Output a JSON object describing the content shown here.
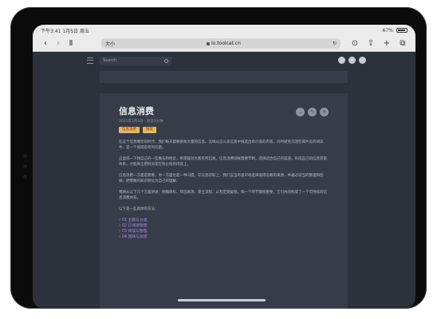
{
  "status": {
    "time": "下午3:41",
    "date": "1月5日 周五",
    "battery": "67%"
  },
  "browser": {
    "address": "lo.toolcat.cn",
    "left_label": "大小"
  },
  "site": {
    "search_placeholder": "Search"
  },
  "article": {
    "title": "信息消费",
    "meta": "2021年1月4日  ·  阅读2分钟",
    "tags": [
      "信息消费",
      "随笔"
    ],
    "paragraphs": [
      "在这个信息爆炸的时代，我们每天都要接收大量的信息。怎样从这么多信息中挑选出有价值的内容，同时避免沉迷在碎片化的阅读中，是一个值得思考的问题。",
      "这里说一下我自己的一些做法和经验，希望能对大家有所启发。信息消费同样需要节制，选择适合自己的渠道，形成自己的信息获取体系，才能真正把时间花在有价值的内容上。",
      "信息消费一方面是需要，另一方面也是一种习惯。在信息获取上，我们应当有意识地选择值得信赖的来源，并通过适当的整理和回顾，把零散的知识转化为自己的理解。",
      "我将从以下几个方面讲讲：明确目标、筛选来源、建立流程、以及定期复盘。每一个环节都很重要，它们共同构成了一个可持续的信息消费体系。",
      "以下是一些具体的方法："
    ],
    "links": [
      "01 主题与分类",
      "02 订阅源管理",
      "03 阅读与整理",
      "04 回顾与总结"
    ]
  }
}
